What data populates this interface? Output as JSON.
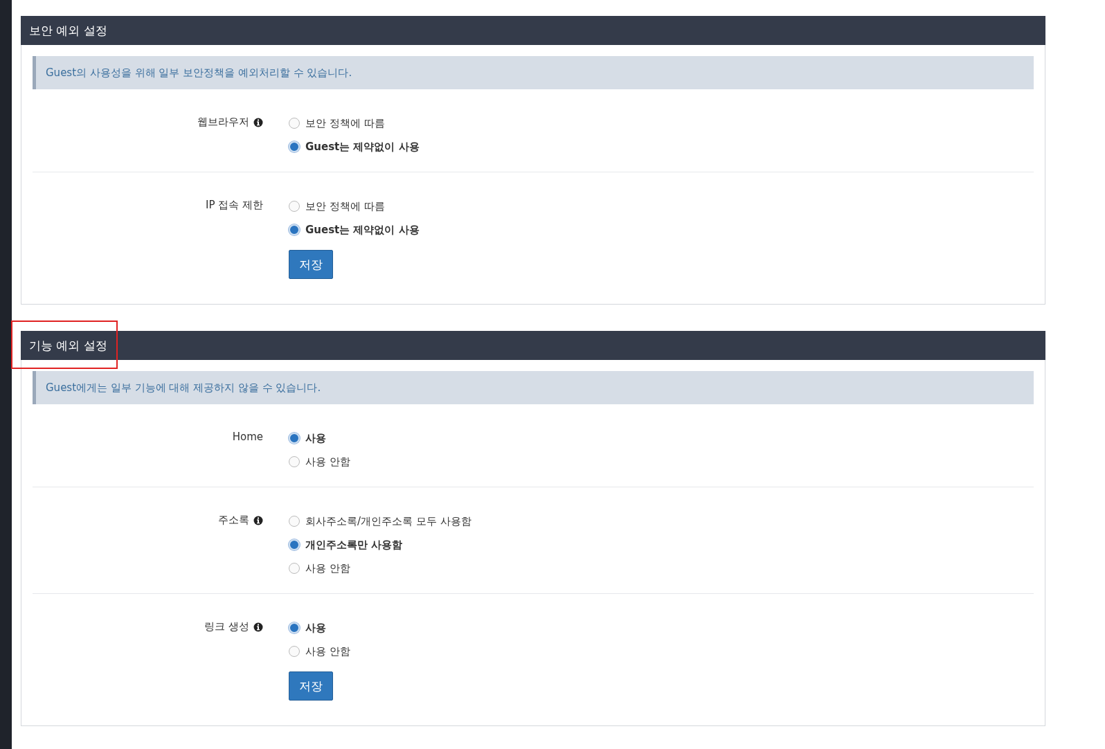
{
  "sections": [
    {
      "title": "보안 예외 설정",
      "highlighted": false,
      "notice": "Guest의 사용성을 위해 일부 보안정책을 예외처리할 수 있습니다.",
      "rows": [
        {
          "label": "웹브라우저",
          "info": true,
          "options": [
            {
              "label": "보안 정책에 따름",
              "selected": false
            },
            {
              "label": "Guest는 제약없이 사용",
              "selected": true
            }
          ]
        },
        {
          "label": "IP 접속 제한",
          "info": false,
          "options": [
            {
              "label": "보안 정책에 따름",
              "selected": false
            },
            {
              "label": "Guest는 제약없이 사용",
              "selected": true
            }
          ]
        }
      ],
      "save_button": "저장"
    },
    {
      "title": "기능 예외 설정",
      "highlighted": true,
      "notice": "Guest에게는 일부 기능에 대해 제공하지 않을 수 있습니다.",
      "rows": [
        {
          "label": "Home",
          "info": false,
          "options": [
            {
              "label": "사용",
              "selected": true
            },
            {
              "label": "사용 안함",
              "selected": false
            }
          ]
        },
        {
          "label": "주소록",
          "info": true,
          "options": [
            {
              "label": "회사주소록/개인주소록 모두 사용함",
              "selected": false
            },
            {
              "label": "개인주소록만 사용함",
              "selected": true
            },
            {
              "label": "사용 안함",
              "selected": false
            }
          ]
        },
        {
          "label": "링크 생성",
          "info": true,
          "options": [
            {
              "label": "사용",
              "selected": true
            },
            {
              "label": "사용 안함",
              "selected": false
            }
          ]
        }
      ],
      "save_button": "저장"
    }
  ]
}
